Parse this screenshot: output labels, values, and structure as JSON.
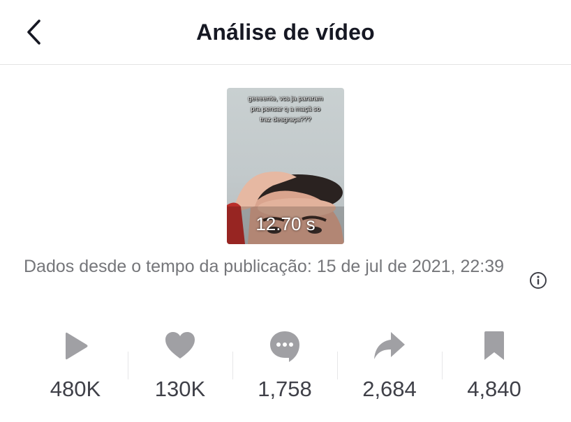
{
  "header": {
    "title": "Análise de vídeo",
    "back_icon": "chevron-left-icon"
  },
  "video": {
    "caption": "geeeente, vcs ja pararam\npra pensar q a maçã so\ntraz desgraça???",
    "duration": "12.70 s"
  },
  "data_since": {
    "text": "Dados desde o tempo da publicação: 15 de jul de 2021, 22:39",
    "info_icon": "info-icon"
  },
  "stats": [
    {
      "icon": "play-icon",
      "value": "480K"
    },
    {
      "icon": "heart-icon",
      "value": "130K"
    },
    {
      "icon": "comment-icon",
      "value": "1,758"
    },
    {
      "icon": "share-icon",
      "value": "2,684"
    },
    {
      "icon": "bookmark-icon",
      "value": "4,840"
    }
  ],
  "colors": {
    "text_primary": "#161823",
    "text_secondary": "#75767a",
    "icon_gray": "#a0a0a4",
    "divider": "#e3e3e4"
  }
}
